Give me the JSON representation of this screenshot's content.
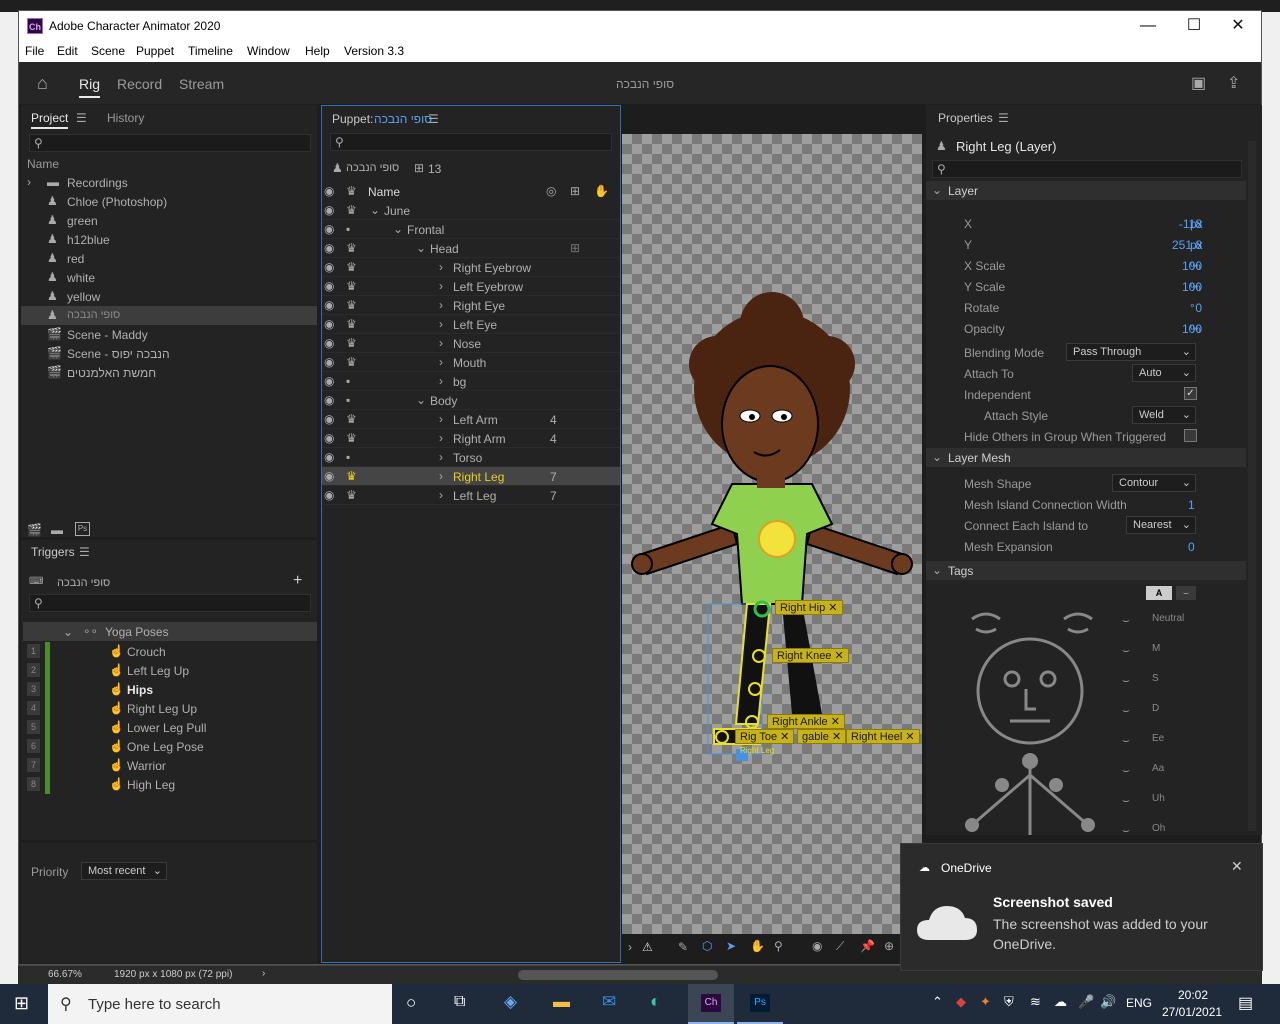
{
  "window": {
    "title": "Adobe Character Animator 2020",
    "app_icon": "Ch"
  },
  "menu": [
    "File",
    "Edit",
    "Scene",
    "Puppet",
    "Timeline",
    "Window",
    "Help",
    "Version 3.3"
  ],
  "workspace": {
    "tabs": [
      "Rig",
      "Record",
      "Stream"
    ],
    "active": "Rig",
    "puppet_title": "סופי הנבכה"
  },
  "project": {
    "tabs": [
      "Project",
      "History"
    ],
    "col_name": "Name",
    "items": [
      {
        "label": "Recordings",
        "icon": "folder-icon"
      },
      {
        "label": "Chloe (Photoshop)",
        "icon": "puppet-icon"
      },
      {
        "label": "green",
        "icon": "puppet-icon"
      },
      {
        "label": "h12blue",
        "icon": "puppet-icon"
      },
      {
        "label": "red",
        "icon": "puppet-icon"
      },
      {
        "label": "white",
        "icon": "puppet-icon"
      },
      {
        "label": "yellow",
        "icon": "puppet-icon"
      },
      {
        "label": "סופי הנבכה",
        "icon": "puppet-icon"
      },
      {
        "label": "Scene - Maddy",
        "icon": "scene-icon"
      },
      {
        "label": "Scene - הנבכה יפוס",
        "icon": "scene-icon"
      },
      {
        "label": "חמשת האלמנטים",
        "icon": "scene-icon"
      }
    ]
  },
  "triggers": {
    "title": "Triggers",
    "puppet": "סופי הנבכה",
    "group": "Yoga Poses",
    "items": [
      "Crouch",
      "Left Leg Up",
      "Hips",
      "Right Leg Up",
      "Lower Leg Pull",
      "One Leg Pose",
      "Warrior",
      "High Leg"
    ],
    "numbers": [
      "1",
      "2",
      "3",
      "4",
      "5",
      "6",
      "7",
      "8"
    ],
    "priority_label": "Priority",
    "priority_value": "Most recent"
  },
  "puppet": {
    "label": "Puppet:",
    "name": "סופי הנבכה",
    "count": "13",
    "col_name": "Name",
    "layers": [
      {
        "label": "June",
        "indent": 0,
        "exp": "v",
        "crown": true,
        "num": ""
      },
      {
        "label": "Frontal",
        "indent": 1,
        "exp": "v",
        "crown": false,
        "num": ""
      },
      {
        "label": "Head",
        "indent": 2,
        "exp": "v",
        "crown": true,
        "num": ""
      },
      {
        "label": "Right Eyebrow",
        "indent": 3,
        "exp": ">",
        "crown": true,
        "num": ""
      },
      {
        "label": "Left Eyebrow",
        "indent": 3,
        "exp": ">",
        "crown": true,
        "num": ""
      },
      {
        "label": "Right Eye",
        "indent": 3,
        "exp": ">",
        "crown": true,
        "num": ""
      },
      {
        "label": "Left Eye",
        "indent": 3,
        "exp": ">",
        "crown": true,
        "num": ""
      },
      {
        "label": "Nose",
        "indent": 3,
        "exp": ">",
        "crown": true,
        "num": ""
      },
      {
        "label": "Mouth",
        "indent": 3,
        "exp": ">",
        "crown": true,
        "num": ""
      },
      {
        "label": "bg",
        "indent": 3,
        "exp": ">",
        "crown": false,
        "num": ""
      },
      {
        "label": "Body",
        "indent": 2,
        "exp": "v",
        "crown": false,
        "num": ""
      },
      {
        "label": "Left Arm",
        "indent": 3,
        "exp": ">",
        "crown": true,
        "num": "4"
      },
      {
        "label": "Right Arm",
        "indent": 3,
        "exp": ">",
        "crown": true,
        "num": "4"
      },
      {
        "label": "Torso",
        "indent": 3,
        "exp": ">",
        "crown": false,
        "num": ""
      },
      {
        "label": "Right Leg",
        "indent": 3,
        "exp": ">",
        "crown": true,
        "num": "7"
      },
      {
        "label": "Left Leg",
        "indent": 3,
        "exp": ">",
        "crown": true,
        "num": "7"
      }
    ]
  },
  "canvas": {
    "tags": [
      "Right Hip",
      "Right Knee",
      "Right Ankle",
      "Toe",
      "Right Heel",
      "Draggable"
    ],
    "toe_prefix": "Rig",
    "drag_suffix": "gable",
    "leg_label": "Right Leg"
  },
  "properties": {
    "title": "Properties",
    "layer_title": "Right Leg (Layer)",
    "layer_section": "Layer",
    "rows": [
      {
        "label": "X",
        "value": "-118",
        "unit": "px"
      },
      {
        "label": "Y",
        "value": "251.8",
        "unit": "px"
      },
      {
        "label": "X Scale",
        "value": "100",
        "unit": "%"
      },
      {
        "label": "Y Scale",
        "value": "100",
        "unit": "%"
      },
      {
        "label": "Rotate",
        "value": "0",
        "unit": "°"
      },
      {
        "label": "Opacity",
        "value": "100",
        "unit": "%"
      }
    ],
    "blending_label": "Blending Mode",
    "blending_value": "Pass Through",
    "attach_label": "Attach To",
    "attach_value": "Auto",
    "independent_label": "Independent",
    "independent": true,
    "attach_style_label": "Attach Style",
    "attach_style_value": "Weld",
    "hide_label": "Hide Others in Group When Triggered",
    "hide": false,
    "mesh_section": "Layer Mesh",
    "mesh_shape_label": "Mesh Shape",
    "mesh_shape_value": "Contour",
    "island_width_label": "Mesh Island Connection Width",
    "island_width_value": "1",
    "connect_label": "Connect Each Island to",
    "connect_value": "Nearest",
    "expansion_label": "Mesh Expansion",
    "expansion_value": "0",
    "tags_section": "Tags",
    "visemes": [
      "Neutral",
      "M",
      "S",
      "D",
      "Ee",
      "Aa",
      "Uh",
      "Oh"
    ]
  },
  "status": {
    "zoom": "66.67%",
    "size": "1920 px x 1080 px (72 ppi)"
  },
  "toast": {
    "app": "OneDrive",
    "title": "Screenshot saved",
    "body": "The screenshot was added to your OneDrive."
  },
  "taskbar": {
    "search_placeholder": "Type here to search",
    "lang": "ENG",
    "time": "20:02",
    "date": "27/01/2021"
  },
  "colors": {
    "accent": "#5aa0f2",
    "tag": "#c8b21a",
    "shirt": "#8fd14f",
    "trigger_green": "#4d8a2c"
  }
}
